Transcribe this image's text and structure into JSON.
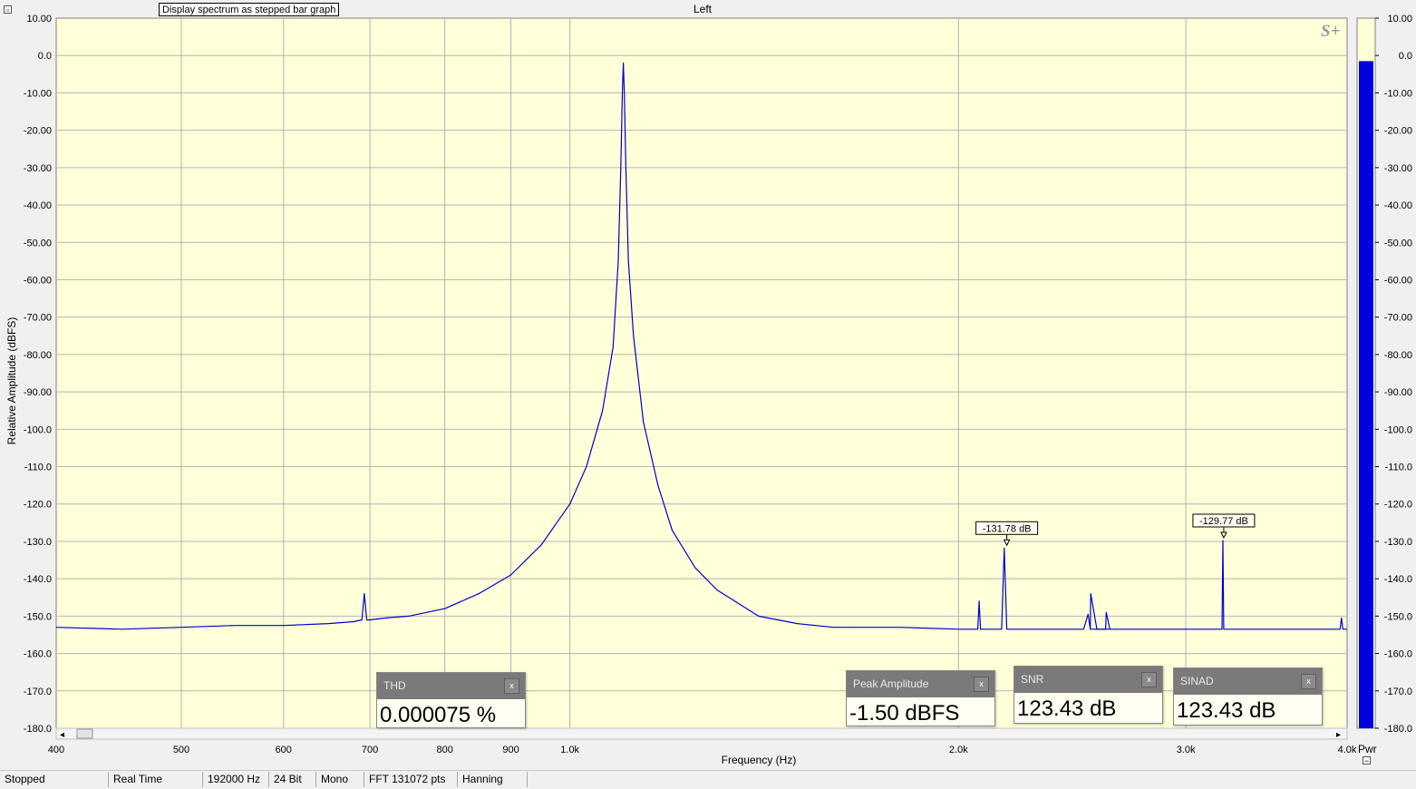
{
  "window": {
    "title": "Left"
  },
  "tooltip_text": "Display spectrum as stepped bar graph",
  "logo_text": "S+",
  "chart_data": {
    "type": "line",
    "title": "Left",
    "xlabel": "Frequency (Hz)",
    "ylabel": "Relative Amplitude (dBFS)",
    "x_scale": "log",
    "xlim": [
      400,
      4000
    ],
    "ylim": [
      -180,
      10
    ],
    "grid": true,
    "x_ticks": [
      {
        "value": 400,
        "label": "400"
      },
      {
        "value": 500,
        "label": "500"
      },
      {
        "value": 600,
        "label": "600"
      },
      {
        "value": 700,
        "label": "700"
      },
      {
        "value": 800,
        "label": "800"
      },
      {
        "value": 900,
        "label": "900"
      },
      {
        "value": 1000,
        "label": "1.0k"
      },
      {
        "value": 2000,
        "label": "2.0k"
      },
      {
        "value": 3000,
        "label": "3.0k"
      },
      {
        "value": 4000,
        "label": "4.0k"
      }
    ],
    "y_ticks": [
      {
        "value": 10,
        "label": "10.00"
      },
      {
        "value": 0,
        "label": "0.0"
      },
      {
        "value": -10,
        "label": "-10.00"
      },
      {
        "value": -20,
        "label": "-20.00"
      },
      {
        "value": -30,
        "label": "-30.00"
      },
      {
        "value": -40,
        "label": "-40.00"
      },
      {
        "value": -50,
        "label": "-50.00"
      },
      {
        "value": -60,
        "label": "-60.00"
      },
      {
        "value": -70,
        "label": "-70.00"
      },
      {
        "value": -80,
        "label": "-80.00"
      },
      {
        "value": -90,
        "label": "-90.00"
      },
      {
        "value": -100,
        "label": "-100.0"
      },
      {
        "value": -110,
        "label": "-110.0"
      },
      {
        "value": -120,
        "label": "-120.0"
      },
      {
        "value": -130,
        "label": "-130.0"
      },
      {
        "value": -140,
        "label": "-140.0"
      },
      {
        "value": -150,
        "label": "-150.0"
      },
      {
        "value": -160,
        "label": "-160.0"
      },
      {
        "value": -170,
        "label": "-170.0"
      },
      {
        "value": -180,
        "label": "-180.0"
      }
    ],
    "series": [
      {
        "color": "#0000c8",
        "x": [
          400,
          450,
          500,
          550,
          600,
          650,
          680,
          690,
          693,
          696,
          700,
          720,
          750,
          800,
          850,
          900,
          950,
          1000,
          1030,
          1060,
          1080,
          1090,
          1095,
          1098,
          1100,
          1102,
          1105,
          1110,
          1120,
          1140,
          1170,
          1200,
          1250,
          1300,
          1400,
          1500,
          1600,
          1800,
          2000,
          2070,
          2075,
          2080,
          2100,
          2160,
          2170,
          2180,
          2300,
          2400,
          2500,
          2520,
          2530,
          2540,
          2600,
          2800,
          3000,
          3100,
          3150,
          3200,
          3205,
          3210,
          3250,
          3400,
          3600,
          3800,
          3900,
          3950,
          3960,
          3970,
          4000
        ],
        "y": [
          -153,
          -153.5,
          -153,
          -152.5,
          -152.5,
          -152,
          -151.5,
          -151,
          -144,
          -151,
          -151,
          -150.5,
          -150,
          -148,
          -144,
          -139,
          -131,
          -120,
          -110,
          -95,
          -78,
          -55,
          -30,
          -10,
          -2,
          -10,
          -30,
          -55,
          -75,
          -98,
          -115,
          -127,
          -137,
          -143,
          -150,
          -152,
          -153,
          -153,
          -153.5,
          -153.5,
          -146,
          -153.5,
          -153.5,
          -153.5,
          -131.78,
          -153.5,
          -153.5,
          -153.5,
          -153.5,
          -149.5,
          -153.5,
          -153.5,
          -153.5,
          -153.5,
          -153.5,
          -153.5,
          -153.5,
          -153.5,
          -129.77,
          -153.5,
          -153.5,
          -153.5,
          -153.5,
          -153.5,
          -153.5,
          -153.5,
          -150.5,
          -153.5,
          -153.5
        ]
      },
      {
        "color": "#0000c8",
        "x": [
          2530,
          2532,
          2560,
          2600,
          2603,
          2620
        ],
        "y": [
          -153.5,
          -144,
          -153.5,
          -153.5,
          -149,
          -153.5
        ]
      }
    ],
    "annotations": [
      {
        "x": 2180,
        "y": -131.78,
        "text": "-131.78 dB"
      },
      {
        "x": 3210,
        "y": -129.77,
        "text": "-129.77 dB"
      }
    ]
  },
  "level_meter": {
    "unit_label": "Pwr",
    "value_db": -1.5,
    "scale_labels": [
      "10.00",
      "0.0",
      "-10.00",
      "-20.00",
      "-30.00",
      "-40.00",
      "-50.00",
      "-60.00",
      "-70.00",
      "-80.00",
      "-90.00",
      "-100.0",
      "-110.0",
      "-120.0",
      "-130.0",
      "-140.0",
      "-150.0",
      "-160.0",
      "-170.0",
      "-180.0"
    ]
  },
  "meters": [
    {
      "label": "THD",
      "value": "0.000075 %"
    },
    {
      "label": "Peak Amplitude",
      "value": "-1.50 dBFS"
    },
    {
      "label": "SNR",
      "value": "123.43 dB"
    },
    {
      "label": "SINAD",
      "value": "123.43 dB"
    }
  ],
  "meter_close_label": "x",
  "status": {
    "state": "Stopped",
    "mode": "Real Time",
    "sample_rate": "192000 Hz",
    "bits": "24 Bit",
    "channels": "Mono",
    "fft": "FFT 131072 pts",
    "window": "Hanning"
  },
  "scroll": {
    "left_arrow": "◂",
    "right_arrow": "▸"
  },
  "colors": {
    "plot_bg": "#ffffd9",
    "trace": "#0000c8",
    "meter_bar": "#0000e0",
    "grid": "#b4b4b4"
  }
}
